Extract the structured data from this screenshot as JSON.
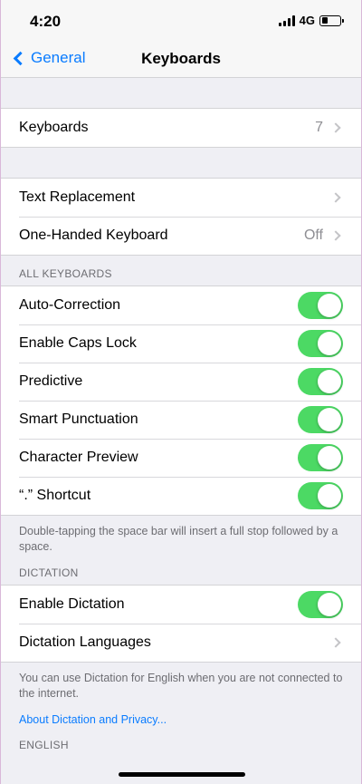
{
  "status": {
    "time": "4:20",
    "network": "4G"
  },
  "nav": {
    "back_label": "General",
    "title": "Keyboards"
  },
  "group1": {
    "keyboards_label": "Keyboards",
    "keyboards_count": "7"
  },
  "group2": {
    "text_replacement_label": "Text Replacement",
    "one_handed_label": "One-Handed Keyboard",
    "one_handed_value": "Off"
  },
  "all_keyboards": {
    "header": "ALL KEYBOARDS",
    "items": [
      {
        "label": "Auto-Correction",
        "on": true
      },
      {
        "label": "Enable Caps Lock",
        "on": true
      },
      {
        "label": "Predictive",
        "on": true
      },
      {
        "label": "Smart Punctuation",
        "on": true
      },
      {
        "label": "Character Preview",
        "on": true
      },
      {
        "label": "“.” Shortcut",
        "on": true
      }
    ],
    "footer": "Double-tapping the space bar will insert a full stop followed by a space."
  },
  "dictation": {
    "header": "DICTATION",
    "enable_label": "Enable Dictation",
    "languages_label": "Dictation Languages",
    "footer": "You can use Dictation for English when you are not connected to the internet.",
    "privacy_link": "About Dictation and Privacy..."
  },
  "english": {
    "header": "ENGLISH"
  },
  "colors": {
    "accent": "#0a7cff",
    "toggle_on": "#4cd964"
  }
}
